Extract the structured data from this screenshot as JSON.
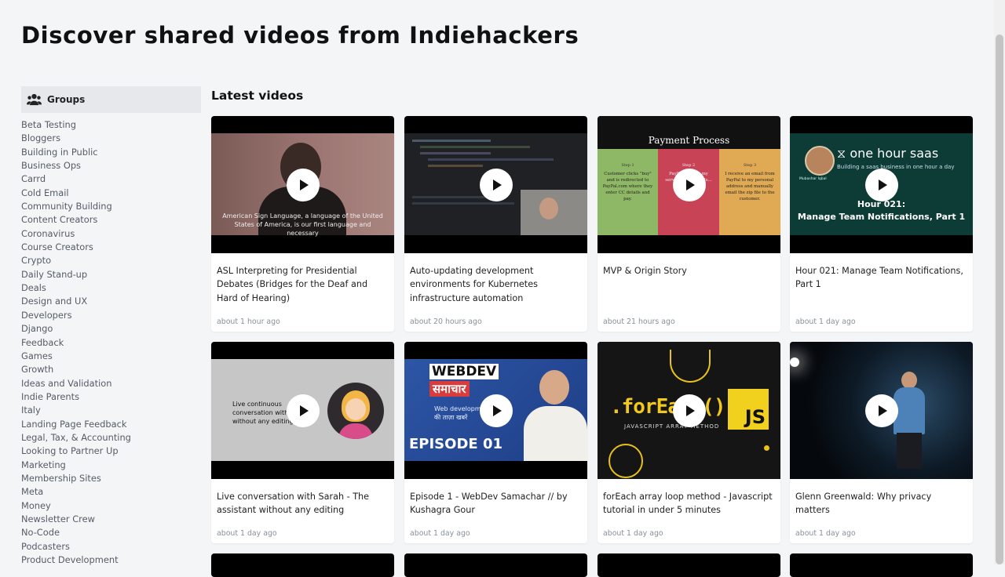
{
  "page": {
    "title": "Discover shared videos from Indiehackers"
  },
  "sidebar": {
    "header": "Groups",
    "header_icon": "users-icon",
    "items": [
      "Beta Testing",
      "Bloggers",
      "Building in Public",
      "Business Ops",
      "Carrd",
      "Cold Email",
      "Community Building",
      "Content Creators",
      "Coronavirus",
      "Course Creators",
      "Crypto",
      "Daily Stand-up",
      "Deals",
      "Design and UX",
      "Developers",
      "Django",
      "Feedback",
      "Games",
      "Growth",
      "Ideas and Validation",
      "Indie Parents",
      "Italy",
      "Landing Page Feedback",
      "Legal, Tax, & Accounting",
      "Looking to Partner Up",
      "Marketing",
      "Membership Sites",
      "Meta",
      "Money",
      "Newsletter Crew",
      "No-Code",
      "Podcasters",
      "Product Development"
    ]
  },
  "main": {
    "section_title": "Latest videos",
    "videos": [
      {
        "title": "ASL Interpreting for Presidential Debates (Bridges for the Deaf and Hard of Hearing)",
        "time": "about 1 hour ago",
        "thumb_caption": "American Sign Language, a language of the United States of America, is our first language and necessary"
      },
      {
        "title": "Auto-updating development environments for Kubernetes infrastructure automation",
        "time": "about 20 hours ago"
      },
      {
        "title": "MVP & Origin Story",
        "time": "about 21 hours ago",
        "thumb_heading": "Payment Process",
        "thumb_steps": [
          "Customer clicks \"buy\" and is redirected to PayPal.com where they enter CC details and pay.",
          "PayPal notifies my server and it emails...",
          "I receive an email from PayPal to my personal address and manually email the zip file to the customer."
        ],
        "thumb_step_labels": [
          "Step 1",
          "Step 2",
          "Step 3"
        ]
      },
      {
        "title": "Hour 021: Manage Team Notifications, Part 1",
        "time": "about 1 day ago",
        "thumb_heading": "⧖ one hour saas",
        "thumb_sub": "Building a saas business in one hour a day",
        "thumb_name": "Mubashar Iqbal",
        "thumb_caption1": "Hour 021:",
        "thumb_caption2": "Manage Team Notifications, Part 1"
      },
      {
        "title": "Live conversation with Sarah - The assistant without any editing",
        "time": "about 1 day ago",
        "thumb_caption": "Live continuous conversation with Sarah without any editing"
      },
      {
        "title": "Episode 1 - WebDev Samachar // by Kushagra Gour",
        "time": "about 1 day ago",
        "thumb_heading": "WEBDEV",
        "thumb_hindi": "समाचार",
        "thumb_sub": "Web development की ताज़ा खबरें",
        "thumb_episode": "EPISODE 01"
      },
      {
        "title": "forEach array loop method - Javascript tutorial in under 5 minutes",
        "time": "about 1 day ago",
        "thumb_heading": ".forEach()",
        "thumb_sub": "JAVASCRIPT ARRAY METHOD",
        "thumb_badge": "JS"
      },
      {
        "title": "Glenn Greenwald: Why privacy matters",
        "time": "about 1 day ago"
      }
    ]
  },
  "colors": {
    "background": "#f4f5f7",
    "card": "#ffffff",
    "sidebar_header": "#e6e8ec"
  }
}
